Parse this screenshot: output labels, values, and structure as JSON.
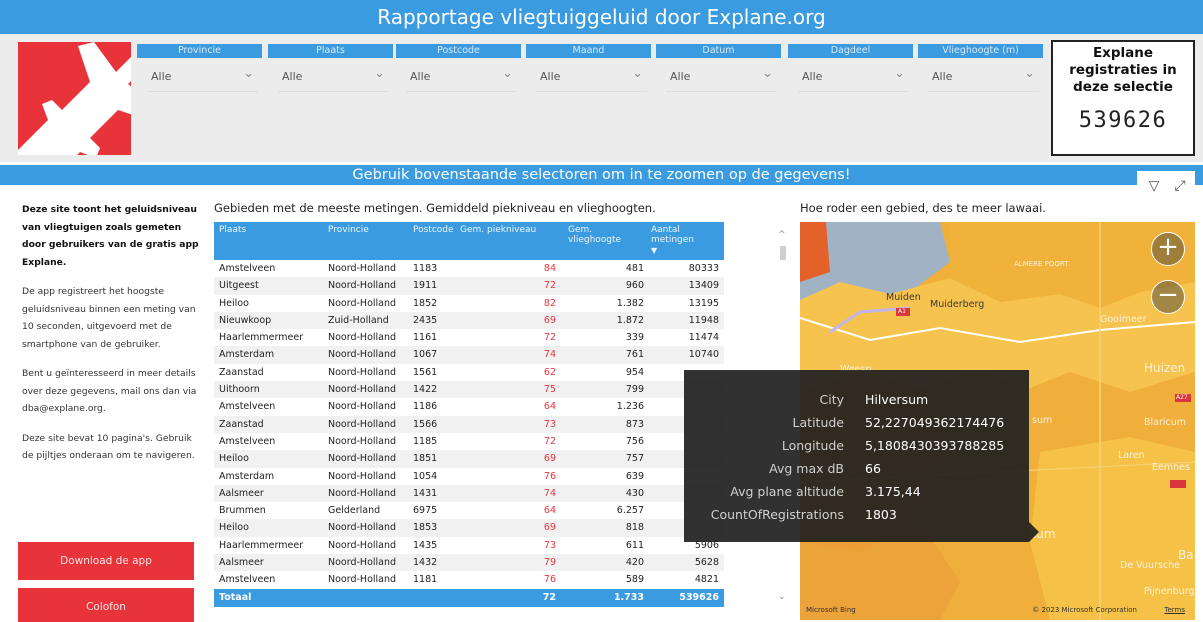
{
  "header": {
    "title": "Rapportage vliegtuiggeluid door Explane.org"
  },
  "filters": [
    {
      "label": "Provincie",
      "value": "Alle"
    },
    {
      "label": "Plaats",
      "value": "Alle"
    },
    {
      "label": "Postcode",
      "value": "Alle"
    },
    {
      "label": "Maand",
      "value": "Alle"
    },
    {
      "label": "Datum",
      "value": "Alle"
    },
    {
      "label": "Dagdeel",
      "value": "Alle"
    },
    {
      "label": "Vlieghoogte (m)",
      "value": "Alle"
    }
  ],
  "kpi": {
    "label": "Explane registraties in deze selectie",
    "value": "539626"
  },
  "hint": "Gebruik bovenstaande selectoren om in te zoomen op de gegevens!",
  "info": {
    "p1": "Deze site toont het geluidsniveau van vliegtuigen zoals gemeten door gebruikers van de gratis app Explane.",
    "p2": "De app registreert het hoogste geluidsniveau binnen een meting van 10 seconden, uitgevoerd met de smartphone van de gebruiker.",
    "p3": "Bent u geïnteresseerd in meer details over deze gegevens, mail ons dan via dba@explane.org.",
    "p4": "Deze site bevat 10 pagina's. Gebruik de pijltjes onderaan om te navigeren."
  },
  "buttons": {
    "download": "Download de app",
    "colofon": "Colofon"
  },
  "table": {
    "title": "Gebieden met de meeste metingen. Gemiddeld piekniveau en vlieghoogten.",
    "columns": [
      "Plaats",
      "Provincie",
      "Postcode",
      "Gem. piekniveau",
      "Gem. vlieghoogte",
      "Aantal metingen"
    ],
    "rows": [
      [
        "Amstelveen",
        "Noord-Holland",
        "1183",
        "84",
        "481",
        "80333"
      ],
      [
        "Uitgeest",
        "Noord-Holland",
        "1911",
        "72",
        "960",
        "13409"
      ],
      [
        "Heiloo",
        "Noord-Holland",
        "1852",
        "82",
        "1.382",
        "13195"
      ],
      [
        "Nieuwkoop",
        "Zuid-Holland",
        "2435",
        "69",
        "1.872",
        "11948"
      ],
      [
        "Haarlemmermeer",
        "Noord-Holland",
        "1161",
        "72",
        "339",
        "11474"
      ],
      [
        "Amsterdam",
        "Noord-Holland",
        "1067",
        "74",
        "761",
        "10740"
      ],
      [
        "Zaanstad",
        "Noord-Holland",
        "1561",
        "62",
        "954",
        ""
      ],
      [
        "Uithoorn",
        "Noord-Holland",
        "1422",
        "75",
        "799",
        ""
      ],
      [
        "Amstelveen",
        "Noord-Holland",
        "1186",
        "64",
        "1.236",
        ""
      ],
      [
        "Zaanstad",
        "Noord-Holland",
        "1566",
        "73",
        "873",
        ""
      ],
      [
        "Amstelveen",
        "Noord-Holland",
        "1185",
        "72",
        "756",
        ""
      ],
      [
        "Heiloo",
        "Noord-Holland",
        "1851",
        "69",
        "757",
        ""
      ],
      [
        "Amsterdam",
        "Noord-Holland",
        "1054",
        "76",
        "639",
        ""
      ],
      [
        "Aalsmeer",
        "Noord-Holland",
        "1431",
        "74",
        "430",
        ""
      ],
      [
        "Brummen",
        "Gelderland",
        "6975",
        "64",
        "6.257",
        ""
      ],
      [
        "Heiloo",
        "Noord-Holland",
        "1853",
        "69",
        "818",
        ""
      ],
      [
        "Haarlemmermeer",
        "Noord-Holland",
        "1435",
        "73",
        "611",
        "5906"
      ],
      [
        "Aalsmeer",
        "Noord-Holland",
        "1432",
        "79",
        "420",
        "5628"
      ],
      [
        "Amstelveen",
        "Noord-Holland",
        "1181",
        "76",
        "589",
        "4821"
      ]
    ],
    "total": [
      "Totaal",
      "72",
      "1.733",
      "539626"
    ]
  },
  "map": {
    "title": "Hoe roder een gebied, des te meer lawaai.",
    "labels": {
      "muiden": "Muiden",
      "muiderberg": "Muiderberg",
      "almere": "ALMERE POORT",
      "gooimeer": "Gooimeer",
      "weesp": "Weesp",
      "huizen": "Huizen",
      "blaricum": "Blaricum",
      "laren": "Laren",
      "eemnes": "Eemnes",
      "sum": "sum",
      "devuursche": "De Vuursche",
      "pijnenburg": "Pijnenburg",
      "ba": "Ba",
      "sum2": "sum",
      "a1": "A1",
      "a27": "A27"
    },
    "footer_left": "Microsoft Bing",
    "footer_right": "© 2023 Microsoft Corporation",
    "footer_terms": "Terms"
  },
  "tooltip": [
    {
      "key": "City",
      "value": "Hilversum"
    },
    {
      "key": "Latitude",
      "value": "52,227049362174476"
    },
    {
      "key": "Longitude",
      "value": "5,1808430393788285"
    },
    {
      "key": "Avg max dB",
      "value": "66"
    },
    {
      "key": "Avg plane altitude",
      "value": "3.175,44"
    },
    {
      "key": "CountOfRegistrations",
      "value": "1803"
    }
  ]
}
